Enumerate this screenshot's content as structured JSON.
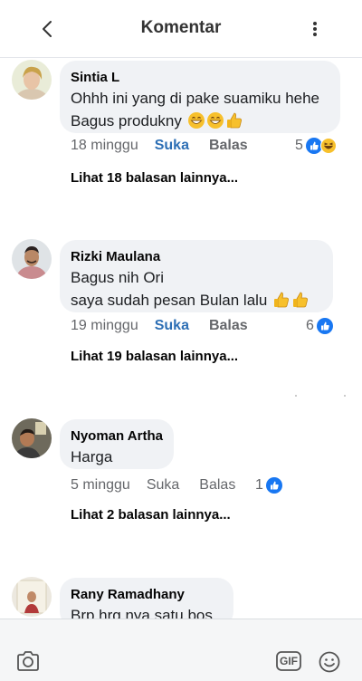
{
  "header": {
    "title": "Komentar"
  },
  "comments": [
    {
      "author": "Sintia L",
      "lines": [
        "Ohhh ini yang di pake suamiku hehe",
        "Bagus produkny"
      ],
      "line2_emojis": [
        "grin-emoji",
        "grin-emoji",
        "thumbs-up-emoji"
      ],
      "time": "18 minggu",
      "like_label": "Suka",
      "reply_label": "Balas",
      "reaction_count": "5",
      "reactions": [
        "like",
        "haha"
      ],
      "more_replies": "Lihat 18 balasan lainnya..."
    },
    {
      "author": "Rizki Maulana",
      "lines": [
        "Bagus nih Ori",
        "saya sudah pesan Bulan lalu"
      ],
      "line2_emojis": [
        "thumbs-up-emoji",
        "thumbs-up-emoji"
      ],
      "time": "19 minggu",
      "like_label": "Suka",
      "reply_label": "Balas",
      "reaction_count": "6",
      "reactions": [
        "like"
      ],
      "more_replies": "Lihat 19 balasan lainnya..."
    },
    {
      "author": "Nyoman Artha",
      "lines": [
        "Harga"
      ],
      "time": "5 minggu",
      "like_label": "Suka",
      "reply_label": "Balas",
      "reaction_count": "1",
      "reactions": [
        "like"
      ],
      "more_replies": "Lihat 2 balasan lainnya..."
    },
    {
      "author": "Rany Ramadhany",
      "lines": [
        "Brp hrg nya satu bos"
      ]
    }
  ],
  "bottom_bar": {
    "camera_icon": "camera-icon",
    "gif_label": "GIF",
    "smile_icon": "smile-icon"
  },
  "colors": {
    "like_active": "#2d6fb5",
    "like_blue": "#1877f2",
    "bubble": "#f0f2f5",
    "meta": "#65676b"
  }
}
